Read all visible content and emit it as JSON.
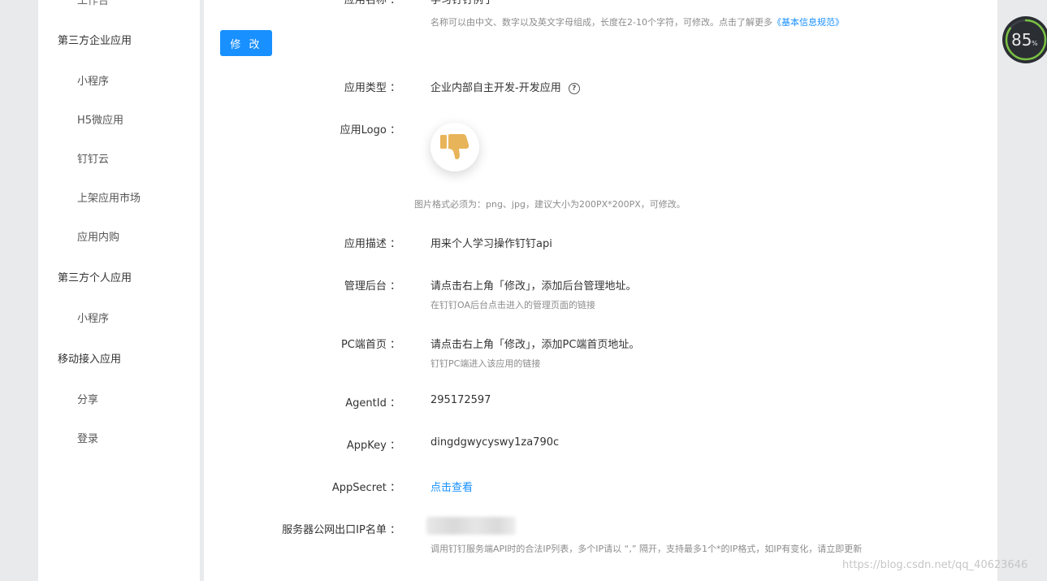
{
  "sidebar": {
    "cut_item": "工作台",
    "groups": [
      {
        "title": "第三方企业应用",
        "items": [
          "小程序",
          "H5微应用",
          "钉钉云",
          "上架应用市场",
          "应用内购"
        ]
      },
      {
        "title": "第三方个人应用",
        "items": [
          "小程序"
        ]
      },
      {
        "title": "移动接入应用",
        "items": [
          "分享",
          "登录"
        ]
      }
    ]
  },
  "main": {
    "edit_button": "修 改",
    "app_name": {
      "label": "应用名称",
      "value": "学习钉钉例子",
      "hint": "名称可以由中文、数字以及英文字母组成，长度在2-10个字符，可修改。点击了解更多",
      "hint_link": "《基本信息规范》"
    },
    "app_type": {
      "label": "应用类型",
      "value": "企业内部自主开发-开发应用",
      "help_icon": "question-circle-icon"
    },
    "app_logo": {
      "label": "应用Logo",
      "logo_icon": "thumbs-down-icon",
      "logo_color": "#e8b45a",
      "hint": "图片格式必须为：png、jpg，建议大小为200PX*200PX，可修改。"
    },
    "app_desc": {
      "label": "应用描述",
      "value": "用来个人学习操作钉钉api"
    },
    "admin": {
      "label": "管理后台",
      "value": "请点击右上角「修改」，添加后台管理地址。",
      "hint": "在钉钉OA后台点击进入的管理页面的链接"
    },
    "pc_home": {
      "label": "PC端首页",
      "value": "请点击右上角「修改」，添加PC端首页地址。",
      "hint": "钉钉PC端进入该应用的链接"
    },
    "agent_id": {
      "label": "AgentId",
      "value": "295172597"
    },
    "app_key": {
      "label": "AppKey",
      "value": "dingdgwycyswy1za790c"
    },
    "app_secret": {
      "label": "AppSecret",
      "value": "点击查看"
    },
    "ip_list": {
      "label": "服务器公网出口IP名单",
      "hint": "调用钉钉服务端API时的合法IP列表，多个IP请以 “,” 隔开，支持最多1个*的IP格式，如IP有变化，请立即更新"
    }
  },
  "overlay": {
    "gauge_value": "85",
    "gauge_unit": "%",
    "gauge_fraction": 0.85,
    "watermark": "https://blog.csdn.net/qq_40623646"
  },
  "colors": {
    "accent": "#1890ff",
    "background": "#e9eaec"
  }
}
